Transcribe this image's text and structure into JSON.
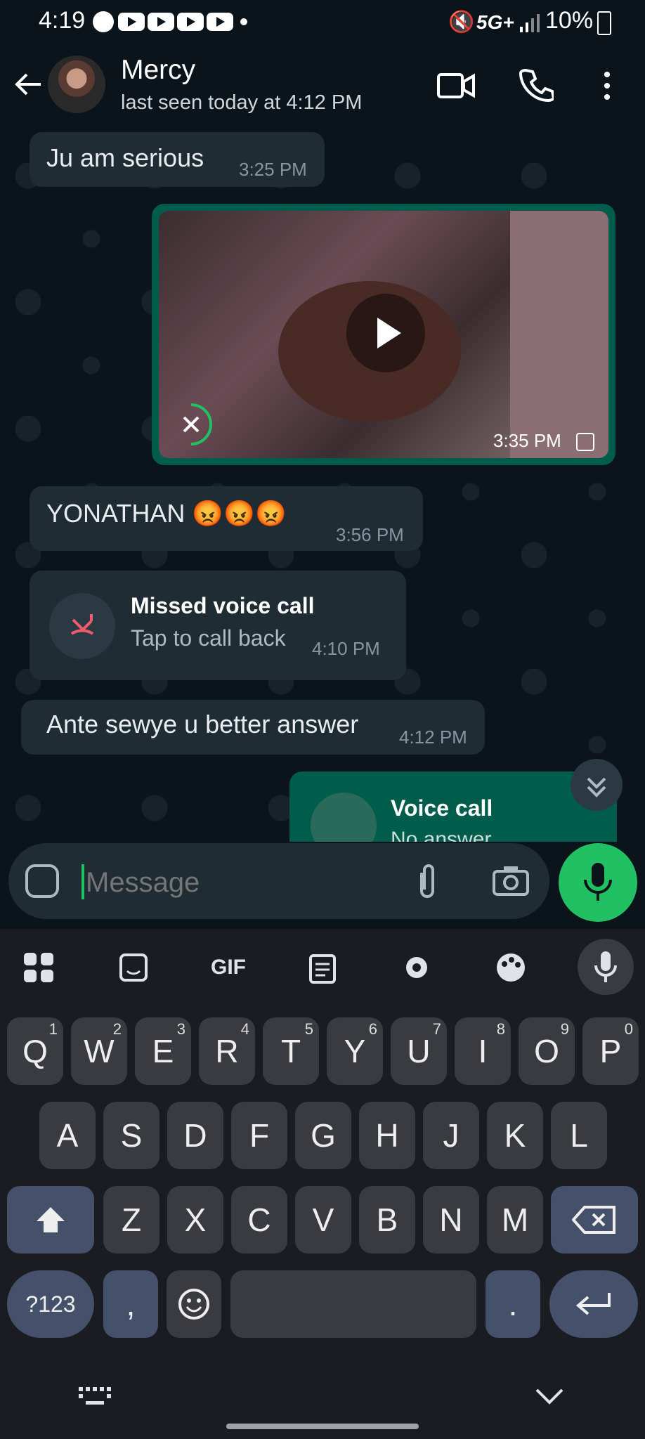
{
  "status_bar": {
    "time": "4:19",
    "network": "5G+",
    "battery": "10%"
  },
  "header": {
    "contact_name": "Mercy",
    "last_seen": "last seen today at 4:12 PM"
  },
  "messages": [
    {
      "text": "Ju am serious",
      "time": "3:25 PM"
    },
    {
      "type": "video",
      "time": "3:35 PM"
    },
    {
      "text": "YONATHAN 😡😡😡",
      "time": "3:56 PM"
    },
    {
      "type": "call",
      "title": "Missed voice call",
      "subtitle": "Tap to call back",
      "time": "4:10 PM"
    },
    {
      "text": "Ante sewye u better answer",
      "time": "4:12 PM"
    },
    {
      "type": "call-outgoing",
      "title": "Voice call",
      "subtitle": "No answer"
    }
  ],
  "composer": {
    "placeholder": "Message"
  },
  "keyboard": {
    "toolbar": {
      "gif": "GIF"
    },
    "row1": [
      "Q",
      "W",
      "E",
      "R",
      "T",
      "Y",
      "U",
      "I",
      "O",
      "P"
    ],
    "row1_sup": [
      "1",
      "2",
      "3",
      "4",
      "5",
      "6",
      "7",
      "8",
      "9",
      "0"
    ],
    "row2": [
      "A",
      "S",
      "D",
      "F",
      "G",
      "H",
      "J",
      "K",
      "L"
    ],
    "row3": [
      "Z",
      "X",
      "C",
      "V",
      "B",
      "N",
      "M"
    ],
    "sym_key": "?123",
    "comma": ",",
    "period": "."
  }
}
